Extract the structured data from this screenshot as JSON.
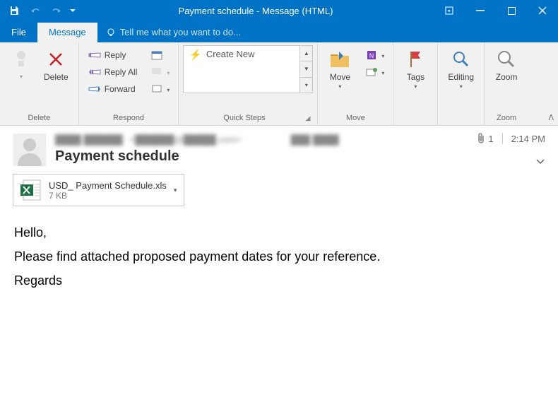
{
  "window": {
    "title": "Payment schedule - Message (HTML)"
  },
  "tabs": {
    "file": "File",
    "message": "Message",
    "tell": "Tell me what you want to do..."
  },
  "ribbon": {
    "delete": {
      "label": "Delete",
      "group": "Delete"
    },
    "respond": {
      "reply": "Reply",
      "replyall": "Reply All",
      "forward": "Forward",
      "group": "Respond"
    },
    "quicksteps": {
      "createnew": "Create New",
      "group": "Quick Steps"
    },
    "move": {
      "move": "Move",
      "group": "Move"
    },
    "tags": {
      "label": "Tags"
    },
    "editing": {
      "label": "Editing"
    },
    "zoom": {
      "label": "Zoom",
      "group": "Zoom"
    }
  },
  "email": {
    "subject": "Payment schedule",
    "time": "2:14 PM",
    "attach_count": "1",
    "attachment": {
      "name": "USD_ Payment Schedule.xls",
      "size": "7 KB"
    },
    "body": {
      "l1": "Hello,",
      "l2": "Please find attached proposed payment dates for your reference.",
      "l3": "Regards"
    }
  }
}
